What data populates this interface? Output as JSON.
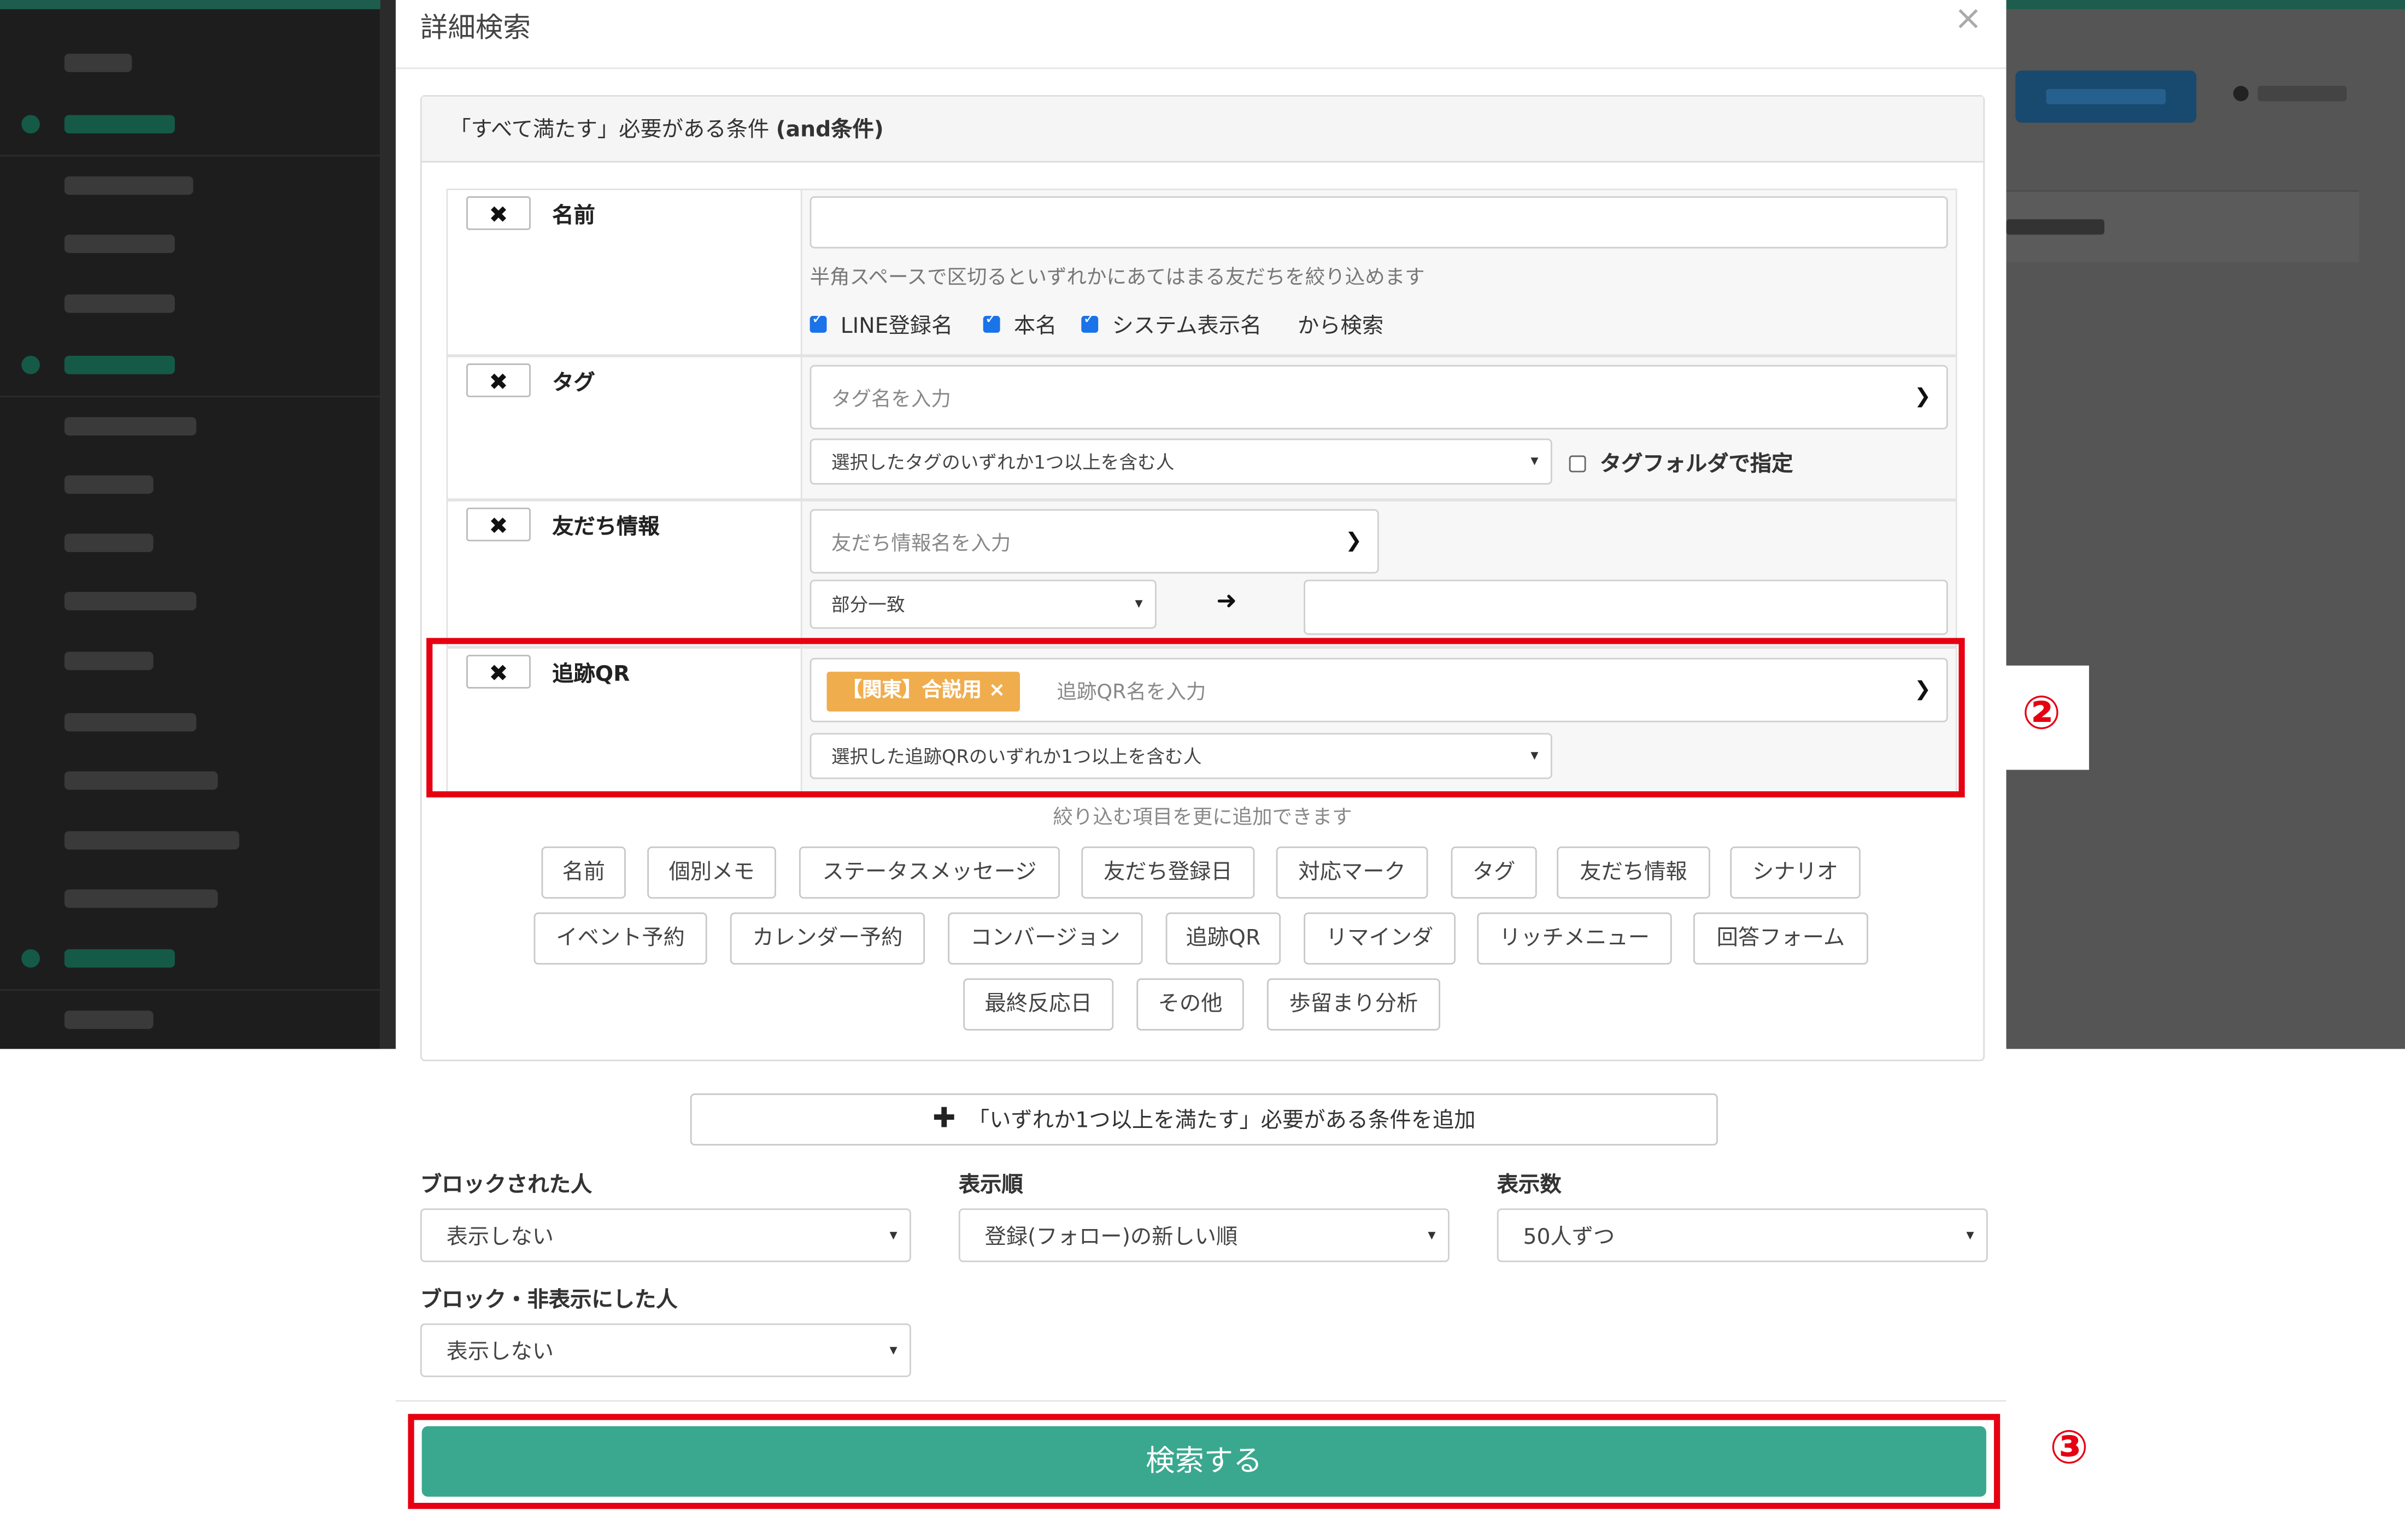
{
  "modal": {
    "title": "詳細検索",
    "close": "×"
  },
  "and_group": {
    "header_prefix": "「すべて満たす」必要がある条件 ",
    "header_bold": "(and条件)"
  },
  "conditions": {
    "name": {
      "remove": "✖",
      "label": "名前",
      "input_value": "",
      "help": "半角スペースで区切るといずれかにあてはまる友だちを絞り込めます",
      "checks": [
        {
          "label": "LINE登録名",
          "checked": true
        },
        {
          "label": "本名",
          "checked": true
        },
        {
          "label": "システム表示名",
          "checked": true
        }
      ],
      "suffix": "から検索"
    },
    "tag": {
      "remove": "✖",
      "label": "タグ",
      "placeholder": "タグ名を入力",
      "mode": "選択したタグのいずれか1つ以上を含む人",
      "folder_label": "タグフォルダで指定"
    },
    "friend_info": {
      "remove": "✖",
      "label": "友だち情報",
      "placeholder": "友だち情報名を入力",
      "match": "部分一致",
      "arrow": "➜",
      "value": ""
    },
    "tracking_qr": {
      "remove": "✖",
      "label": "追跡QR",
      "chip": "【関東】合説用 ×",
      "placeholder": "追跡QR名を入力",
      "mode": "選択した追跡QRのいずれか1つ以上を含む人"
    }
  },
  "add_note": "絞り込む項目を更に追加できます",
  "add_items_row1": [
    "名前",
    "個別メモ",
    "ステータスメッセージ",
    "友だち登録日",
    "対応マーク",
    "タグ",
    "友だち情報",
    "シナリオ"
  ],
  "add_items_row2": [
    "イベント予約",
    "カレンダー予約",
    "コンバージョン",
    "追跡QR",
    "リマインダ",
    "リッチメニュー",
    "回答フォーム"
  ],
  "add_items_row3": [
    "最終反応日",
    "その他",
    "歩留まり分析"
  ],
  "or_button": {
    "plus": "✚",
    "label": "「いずれか1つ以上を満たす」必要がある条件を追加"
  },
  "filters": {
    "blocked": {
      "label": "ブロックされた人",
      "value": "表示しない"
    },
    "order": {
      "label": "表示順",
      "value": "登録(フォロー)の新しい順"
    },
    "per_page": {
      "label": "表示数",
      "value": "50人ずつ"
    },
    "blocked_hidden": {
      "label": "ブロック・非表示にした人",
      "value": "表示しない"
    }
  },
  "search_button": "検索する",
  "annotations": {
    "step2": "②",
    "step3": "③",
    "color": "#e60012"
  },
  "colors": {
    "accent": "#3aa88f",
    "chip": "#f0ad4e",
    "checkbox": "#1a73e8"
  }
}
